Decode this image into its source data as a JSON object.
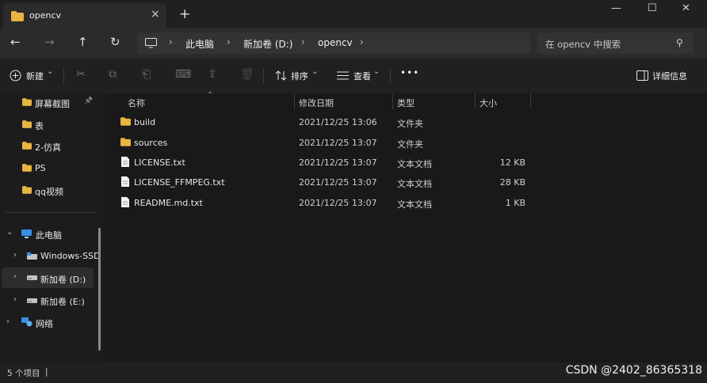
{
  "window": {
    "tab_title": "opencv",
    "tab_close_icon": "×",
    "new_tab_icon": "+",
    "minimize_icon": "—",
    "maximize_icon": "☐",
    "close_icon": "✕"
  },
  "nav": {
    "back_icon": "←",
    "forward_icon": "→",
    "up_icon": "↑",
    "refresh_icon": "↻"
  },
  "breadcrumb": {
    "sep": "›",
    "items": [
      "此电脑",
      "新加卷 (D:)",
      "opencv"
    ]
  },
  "search": {
    "placeholder": "在 opencv 中搜索",
    "icon": "⚲"
  },
  "toolbar": {
    "new_label": "新建",
    "new_chevron": "⌄",
    "cut_icon": "✂",
    "copy_icon": "⧉",
    "paste_icon": "⎗",
    "rename_icon": "⌨",
    "share_icon": "⇪",
    "delete_icon": "🗑",
    "sort_label": "排序",
    "sort_chevron": "⌄",
    "view_label": "查看",
    "view_chevron": "⌄",
    "more_icon": "•••",
    "details_label": "详细信息"
  },
  "sidebar": {
    "quick_access": [
      {
        "label": "屏幕截图",
        "pin": "📌"
      },
      {
        "label": "表"
      },
      {
        "label": "2-仿真"
      },
      {
        "label": "PS"
      },
      {
        "label": "qq视频"
      }
    ],
    "this_pc": {
      "label": "此电脑",
      "chevron": "⌄"
    },
    "drives": [
      {
        "label": "Windows-SSD",
        "chevron": "›"
      },
      {
        "label": "新加卷 (D:)",
        "chevron": "›"
      },
      {
        "label": "新加卷 (E:)",
        "chevron": "›"
      }
    ],
    "network": {
      "label": "网络",
      "chevron": "›"
    }
  },
  "columns": {
    "name": "名称",
    "modified": "修改日期",
    "type": "类型",
    "size": "大小",
    "sort_arrow": "⌃"
  },
  "files": [
    {
      "name": "build",
      "modified": "2021/12/25 13:06",
      "type": "文件夹",
      "size": "",
      "kind": "folder"
    },
    {
      "name": "sources",
      "modified": "2021/12/25 13:07",
      "type": "文件夹",
      "size": "",
      "kind": "folder"
    },
    {
      "name": "LICENSE.txt",
      "modified": "2021/12/25 13:07",
      "type": "文本文档",
      "size": "12 KB",
      "kind": "doc"
    },
    {
      "name": "LICENSE_FFMPEG.txt",
      "modified": "2021/12/25 13:07",
      "type": "文本文档",
      "size": "28 KB",
      "kind": "doc"
    },
    {
      "name": "README.md.txt",
      "modified": "2021/12/25 13:07",
      "type": "文本文档",
      "size": "1 KB",
      "kind": "doc"
    }
  ],
  "status": {
    "item_count": "5 个项目",
    "sep": "|"
  },
  "watermark": "CSDN @2402_86365318",
  "colors": {
    "folder": "#e8b442",
    "accent": "#4cc2ff"
  }
}
